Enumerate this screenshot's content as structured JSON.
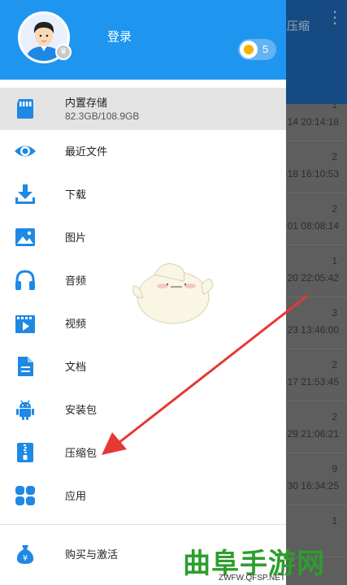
{
  "background": {
    "toolbar_title": "压缩",
    "more_icon": "⋮",
    "rows": [
      {
        "count": "1",
        "date": "-14 20:14:18"
      },
      {
        "count": "2",
        "date": "-18 16:10:53"
      },
      {
        "count": "2",
        "date": "01 08:08:14"
      },
      {
        "count": "1",
        "date": "20 22:05:42"
      },
      {
        "count": "3",
        "date": "23 13:46:00"
      },
      {
        "count": "2",
        "date": "-17 21:53:45"
      },
      {
        "count": "2",
        "date": "-29 21:06:21"
      },
      {
        "count": "9",
        "date": "30 16:34:25"
      },
      {
        "count": "1",
        "date": ""
      }
    ]
  },
  "header": {
    "login_label": "登录",
    "coin_count": "5"
  },
  "menu": {
    "storage": {
      "label": "内置存储",
      "usage": "82.3GB/108.9GB",
      "icon": "sd-card-icon"
    },
    "items": [
      {
        "label": "最近文件",
        "icon": "eye-icon"
      },
      {
        "label": "下载",
        "icon": "download-icon"
      },
      {
        "label": "图片",
        "icon": "image-icon"
      },
      {
        "label": "音频",
        "icon": "headphones-icon"
      },
      {
        "label": "视频",
        "icon": "video-icon"
      },
      {
        "label": "文档",
        "icon": "document-icon"
      },
      {
        "label": "安装包",
        "icon": "android-icon"
      },
      {
        "label": "压缩包",
        "icon": "zip-icon"
      },
      {
        "label": "应用",
        "icon": "apps-icon"
      }
    ],
    "purchase": {
      "label": "购买与激活",
      "icon": "money-bag-icon"
    }
  },
  "watermark": {
    "text": "曲阜手游网",
    "url": "ZWFW.QFSP.NET"
  },
  "colors": {
    "accent": "#1e96f0",
    "icon_blue": "#1e88e5",
    "annotation_red": "#e53935"
  }
}
